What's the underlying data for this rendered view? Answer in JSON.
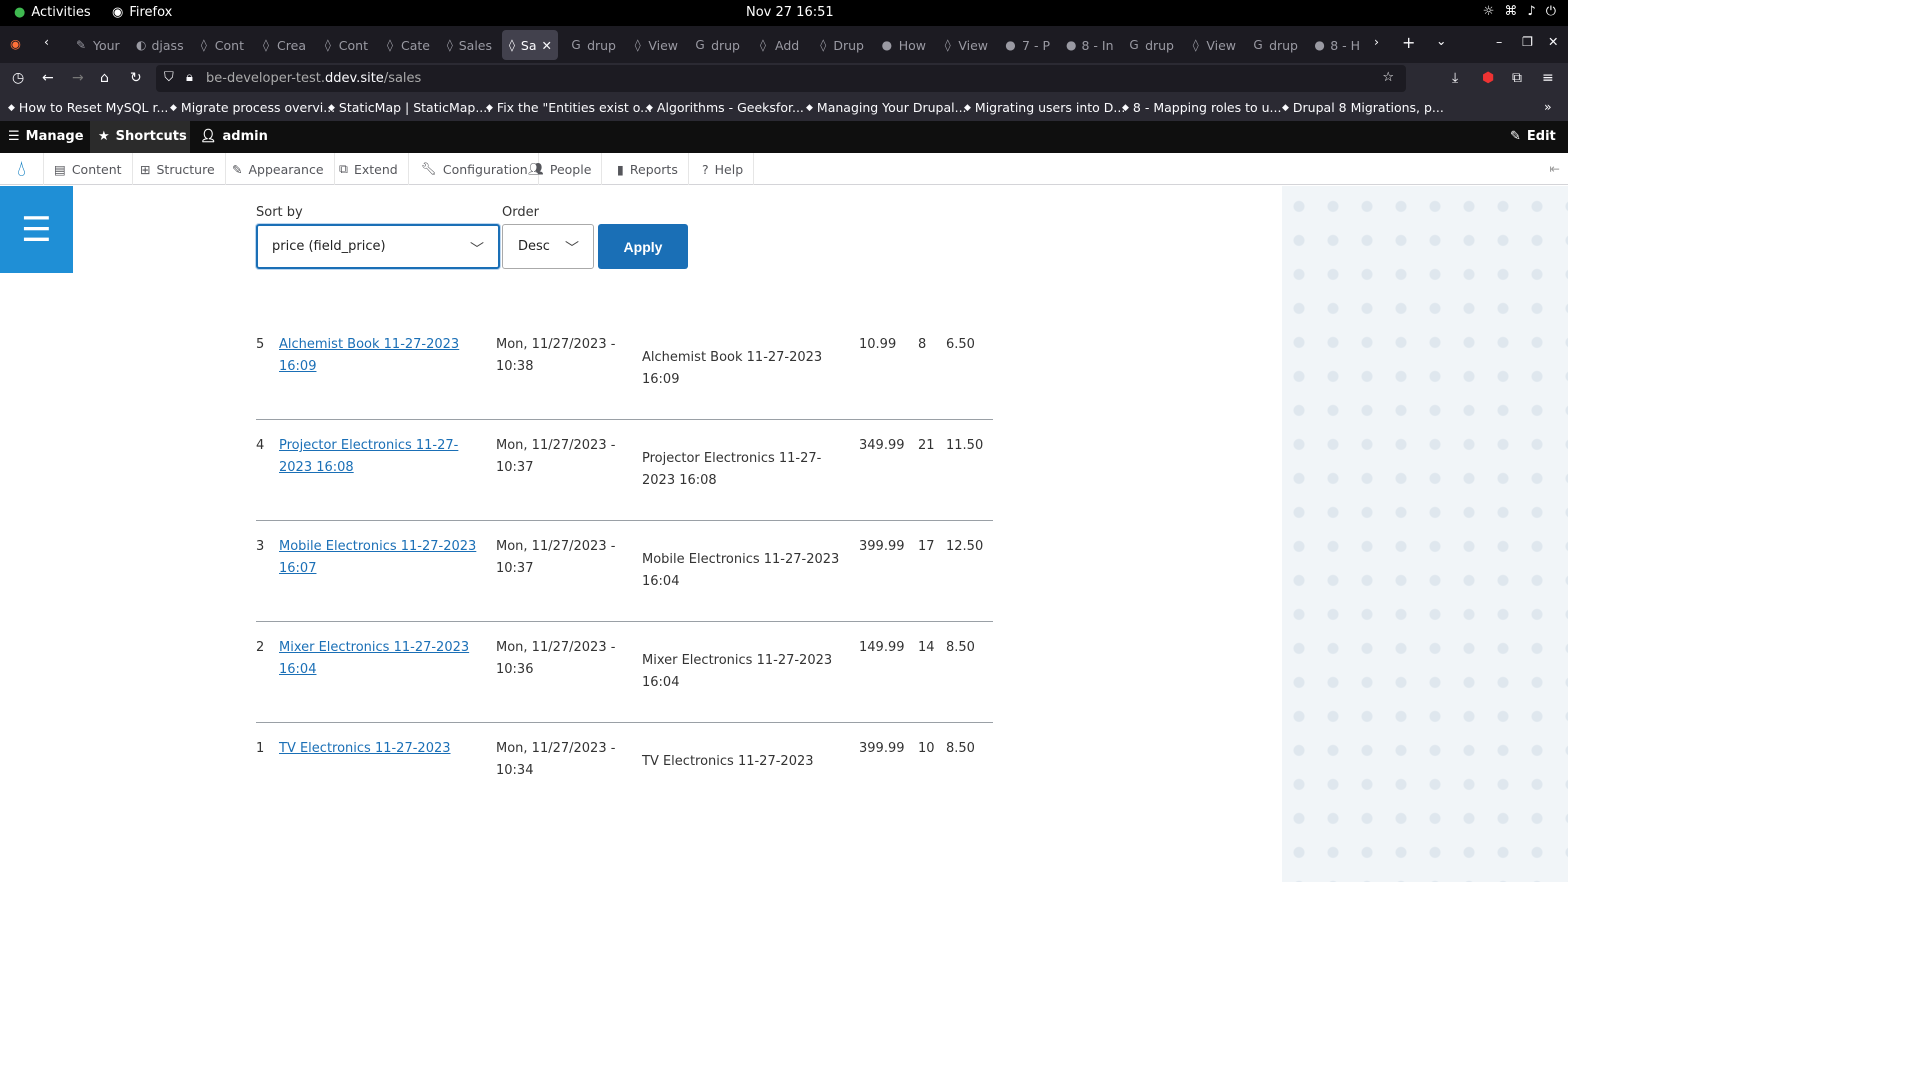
{
  "system": {
    "activities": "Activities",
    "app": "Firefox",
    "clock": "Nov 27  16:51"
  },
  "tabs": [
    {
      "icon": "pen-icon",
      "label": "Your"
    },
    {
      "icon": "github-icon",
      "label": "djass"
    },
    {
      "icon": "drupal-icon",
      "label": "Cont"
    },
    {
      "icon": "drupal-icon",
      "label": "Crea"
    },
    {
      "icon": "drupal-icon",
      "label": "Cont"
    },
    {
      "icon": "drupal-icon",
      "label": "Cate"
    },
    {
      "icon": "drupal-icon",
      "label": "Sales"
    },
    {
      "icon": "drupal-icon",
      "label": "Sa",
      "active": true
    },
    {
      "icon": "google-icon",
      "label": "drup"
    },
    {
      "icon": "drupal-icon",
      "label": "View"
    },
    {
      "icon": "google-icon",
      "label": "drup"
    },
    {
      "icon": "drupal-icon",
      "label": "Add"
    },
    {
      "icon": "drupal-icon",
      "label": "Drup"
    },
    {
      "icon": "reddit-icon",
      "label": "How"
    },
    {
      "icon": "drupal-icon",
      "label": "View"
    },
    {
      "icon": "drop-icon",
      "label": "7 - P"
    },
    {
      "icon": "drop-icon",
      "label": "8 - In"
    },
    {
      "icon": "google-icon",
      "label": "drup"
    },
    {
      "icon": "drupal-icon",
      "label": "View"
    },
    {
      "icon": "google-icon",
      "label": "drup"
    },
    {
      "icon": "drop-icon",
      "label": "8 - H"
    }
  ],
  "url": {
    "prefix": "be-developer-test.",
    "host": "ddev.site",
    "path": "/sales"
  },
  "bookmarks": [
    "How to Reset MySQL r...",
    "Migrate process overvi...",
    "StaticMap | StaticMap....",
    "Fix the \"Entities exist o...",
    "Algorithms - Geeksfor...",
    "Managing Your Drupal...",
    "Migrating users into D...",
    "8 - Mapping roles to u...",
    "Drupal 8 Migrations, p..."
  ],
  "toolbar": {
    "manage": "Manage",
    "shortcuts": "Shortcuts",
    "user": "admin",
    "edit": "Edit"
  },
  "admin_menu": [
    "Content",
    "Structure",
    "Appearance",
    "Extend",
    "Configuration",
    "People",
    "Reports",
    "Help"
  ],
  "form": {
    "sort_label": "Sort by",
    "sort_value": "price (field_price)",
    "order_label": "Order",
    "order_value": "Desc",
    "apply": "Apply"
  },
  "rows": [
    {
      "n": "5",
      "title": "Alchemist Book 11-27-2023 16:09",
      "date": "Mon, 11/27/2023 - 10:38",
      "name": "Alchemist Book 11-27-2023 16:09",
      "price": "10.99",
      "qty": "8",
      "cost": "6.50"
    },
    {
      "n": "4",
      "title": "Projector Electronics 11-27-2023 16:08",
      "date": "Mon, 11/27/2023 - 10:37",
      "name": "Projector Electronics 11-27-2023 16:08",
      "price": "349.99",
      "qty": "21",
      "cost": "11.50"
    },
    {
      "n": "3",
      "title": "Mobile Electronics 11-27-2023 16:07",
      "date": "Mon, 11/27/2023 - 10:37",
      "name": "Mobile Electronics 11-27-2023 16:04",
      "price": "399.99",
      "qty": "17",
      "cost": "12.50"
    },
    {
      "n": "2",
      "title": "Mixer Electronics 11-27-2023 16:04",
      "date": "Mon, 11/27/2023 - 10:36",
      "name": "Mixer Electronics 11-27-2023 16:04",
      "price": "149.99",
      "qty": "14",
      "cost": "8.50"
    },
    {
      "n": "1",
      "title": "TV Electronics 11-27-2023",
      "date": "Mon, 11/27/2023 - 10:34",
      "name": "TV Electronics 11-27-2023",
      "price": "399.99",
      "qty": "10",
      "cost": "8.50"
    }
  ]
}
